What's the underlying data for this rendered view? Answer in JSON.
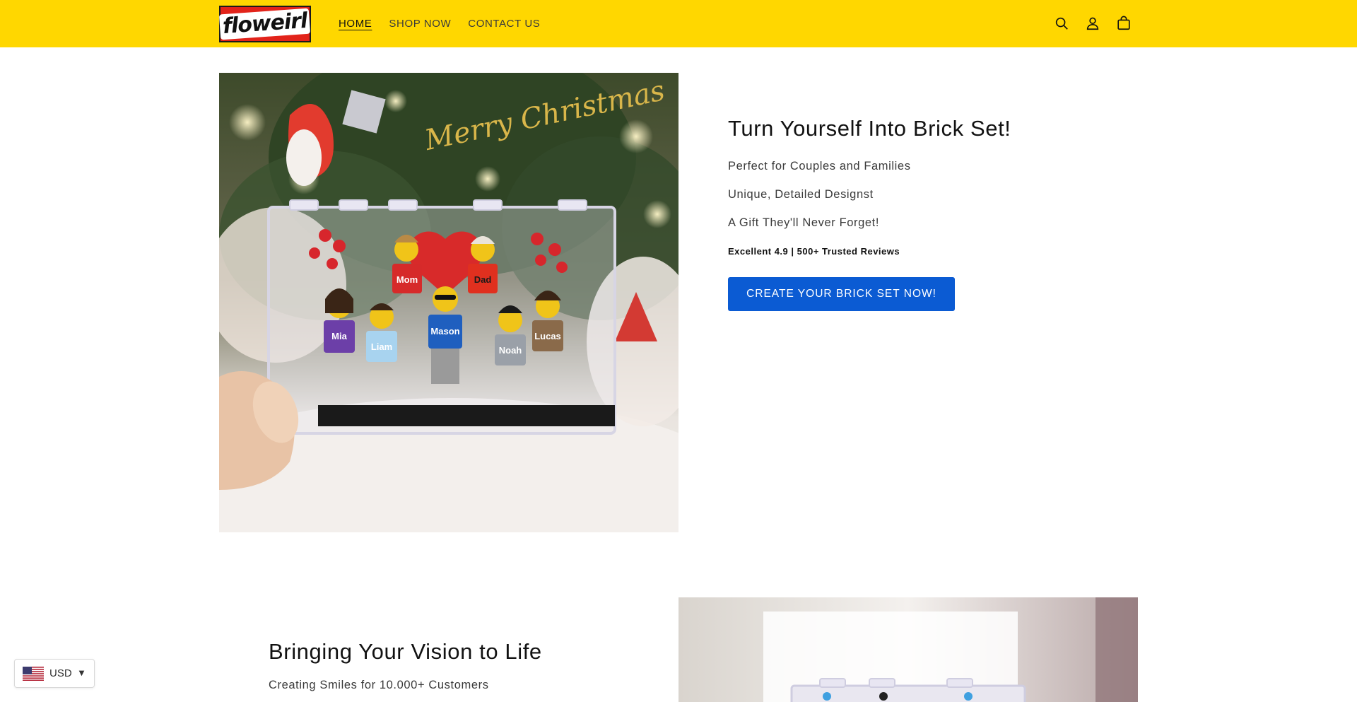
{
  "header": {
    "logo_text": "floweirl",
    "nav": [
      {
        "label": "HOME",
        "active": true
      },
      {
        "label": "SHOP NOW",
        "active": false
      },
      {
        "label": "CONTACT US",
        "active": false
      }
    ],
    "icons": [
      "search-icon",
      "account-icon",
      "cart-icon"
    ],
    "background": "#ffd700"
  },
  "hero": {
    "image_labels": {
      "banner": "Merry Christmas",
      "figures": [
        "Mom",
        "Dad",
        "Mia",
        "Liam",
        "Mason",
        "Noah",
        "Lucas"
      ]
    },
    "title": "Turn Yourself Into Brick Set!",
    "bullets": [
      {
        "mark": "",
        "text": " Perfect for Couples and Families"
      },
      {
        "mark": "",
        "text": " Unique, Detailed Designst"
      },
      {
        "mark": "",
        "text": " A Gift They'll Never Forget!"
      }
    ],
    "reviews_stars": "",
    "reviews_text": "Excellent 4.9 | 500+ Trusted Reviews",
    "cta_label": "CREATE YOUR BRICK SET NOW!",
    "cta_color": "#0b5bd3"
  },
  "section2": {
    "title": "Bringing Your Vision to Life",
    "subtitle": "Creating Smiles for 10.000+ Customers"
  },
  "currency": {
    "code": "USD",
    "flag_icon": "us-flag-icon"
  }
}
